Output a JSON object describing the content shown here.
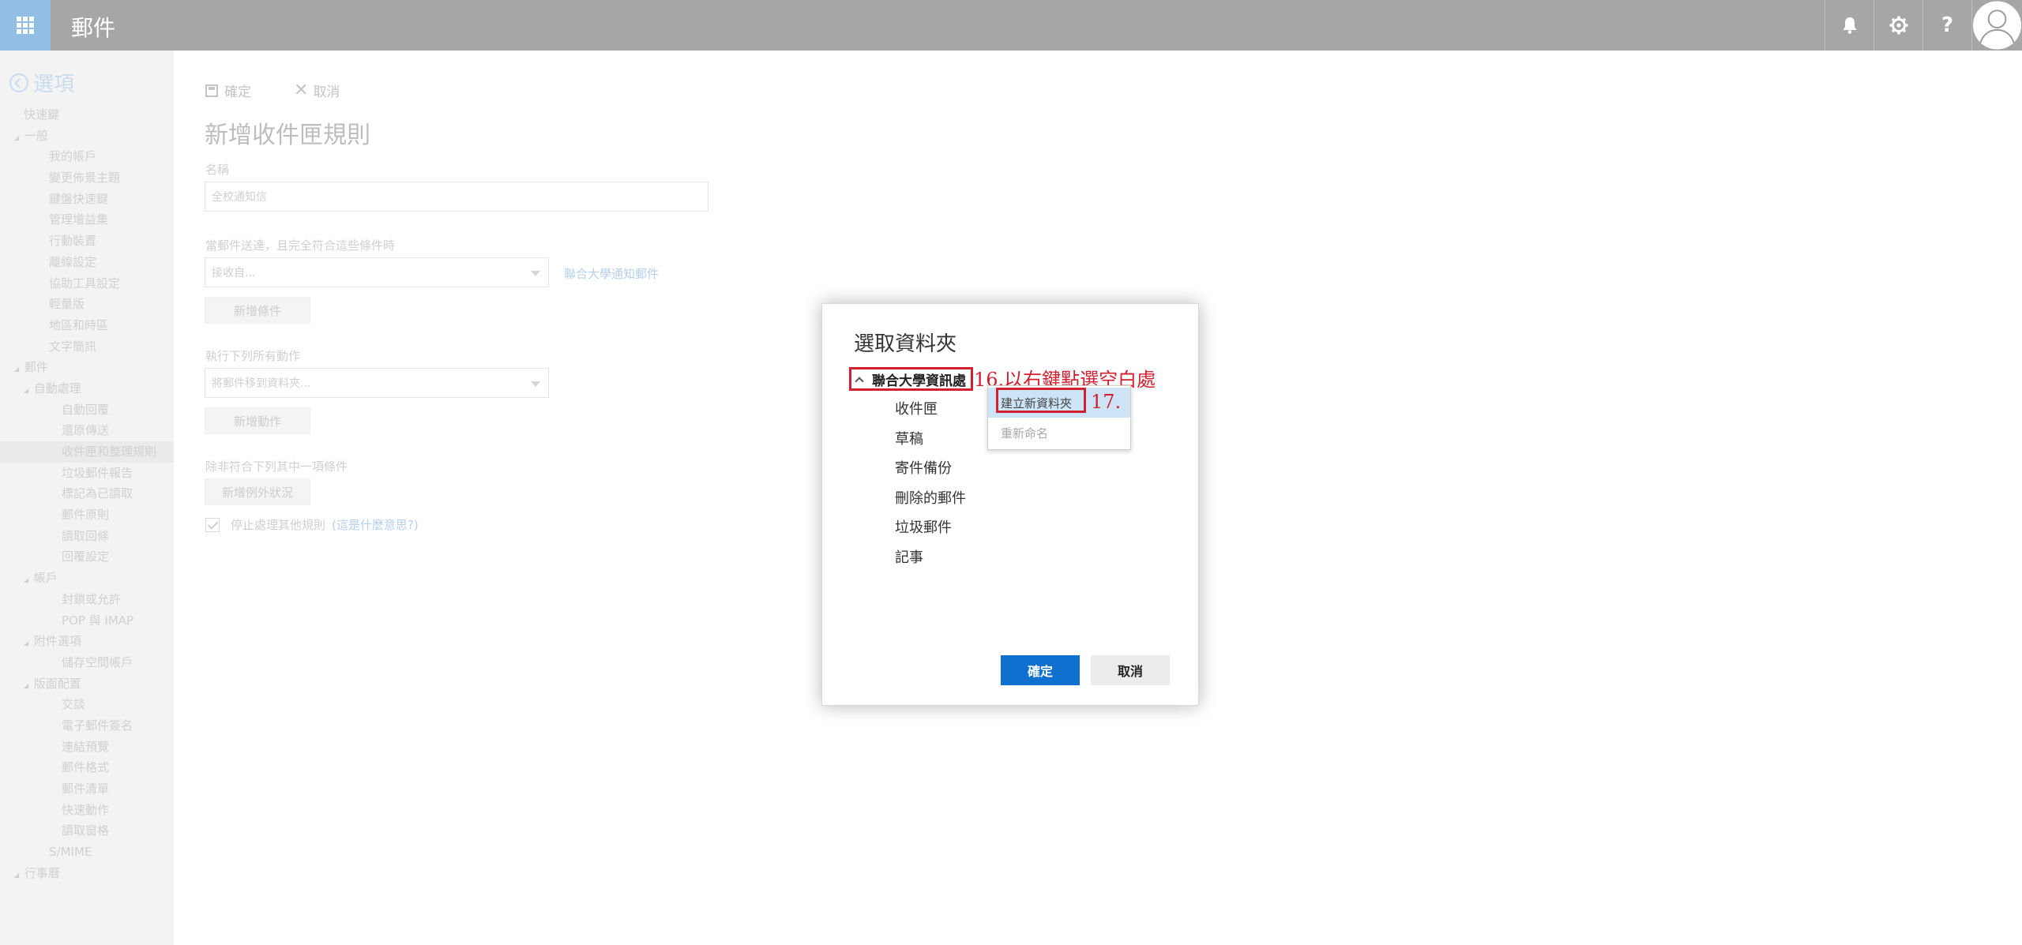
{
  "header": {
    "app_title": "郵件",
    "launcher_icon": "app-launcher-icon",
    "icons": [
      "bell-icon",
      "gear-icon",
      "help-icon",
      "avatar-icon"
    ],
    "help_label": "?"
  },
  "sidebar": {
    "title": "選項",
    "items": [
      {
        "label": "快速鍵",
        "indent": 30
      },
      {
        "label": "一般",
        "indent": 30,
        "caret": true
      },
      {
        "label": "我的帳戶",
        "indent": 62
      },
      {
        "label": "變更佈景主題",
        "indent": 62
      },
      {
        "label": "鍵盤快速鍵",
        "indent": 62
      },
      {
        "label": "管理增益集",
        "indent": 62
      },
      {
        "label": "行動裝置",
        "indent": 62
      },
      {
        "label": "離線設定",
        "indent": 62
      },
      {
        "label": "協助工具設定",
        "indent": 62
      },
      {
        "label": "輕量版",
        "indent": 62
      },
      {
        "label": "地區和時區",
        "indent": 62
      },
      {
        "label": "文字簡訊",
        "indent": 62
      },
      {
        "label": "郵件",
        "indent": 30,
        "caret": true
      },
      {
        "label": "自動處理",
        "indent": 42,
        "caret": true
      },
      {
        "label": "自動回覆",
        "indent": 78
      },
      {
        "label": "還原傳送",
        "indent": 78
      },
      {
        "label": "收件匣和整理規則",
        "indent": 78,
        "selected": true
      },
      {
        "label": "垃圾郵件報告",
        "indent": 78
      },
      {
        "label": "標記為已讀取",
        "indent": 78
      },
      {
        "label": "郵件原則",
        "indent": 78
      },
      {
        "label": "讀取回條",
        "indent": 78
      },
      {
        "label": "回覆設定",
        "indent": 78
      },
      {
        "label": "帳戶",
        "indent": 42,
        "caret": true
      },
      {
        "label": "封鎖或允許",
        "indent": 78
      },
      {
        "label": "POP 與 IMAP",
        "indent": 78
      },
      {
        "label": "附件選項",
        "indent": 42,
        "caret": true
      },
      {
        "label": "儲存空間帳戶",
        "indent": 78
      },
      {
        "label": "版面配置",
        "indent": 42,
        "caret": true
      },
      {
        "label": "交談",
        "indent": 78
      },
      {
        "label": "電子郵件簽名",
        "indent": 78
      },
      {
        "label": "連結預覽",
        "indent": 78
      },
      {
        "label": "郵件格式",
        "indent": 78
      },
      {
        "label": "郵件清單",
        "indent": 78
      },
      {
        "label": "快速動作",
        "indent": 78
      },
      {
        "label": "讀取窗格",
        "indent": 78
      },
      {
        "label": "S/MIME",
        "indent": 62
      },
      {
        "label": "行事曆",
        "indent": 30,
        "caret": true
      }
    ]
  },
  "main": {
    "save_label": "確定",
    "cancel_label": "取消",
    "page_title": "新增收件匣規則",
    "name_label": "名稱",
    "name_value": "全校通知信",
    "condition_label": "當郵件送達，且完全符合這些條件時",
    "condition_value": "接收自...",
    "condition_link": "聯合大學通知郵件",
    "add_condition": "新增條件",
    "action_label": "執行下列所有動作",
    "action_value": "將郵件移到資料夾...",
    "add_action": "新增動作",
    "exception_label": "除非符合下列其中一項條件",
    "add_exception": "新增例外狀況",
    "stop_label": "停止處理其他規則",
    "stop_link": "(這是什麼意思?)"
  },
  "dialog": {
    "title": "選取資料夾",
    "root_folder": "聯合大學資訊處",
    "annotation_16": "16.以右鍵點選空白處",
    "annotation_17": "17.",
    "folders": [
      "收件匣",
      "草稿",
      "寄件備份",
      "刪除的郵件",
      "垃圾郵件",
      "記事"
    ],
    "context_menu": {
      "new_folder": "建立新資料夾",
      "rename": "重新命名"
    },
    "ok_label": "確定",
    "cancel_label": "取消"
  },
  "colors": {
    "topbar": "#a6a6a6",
    "launcher": "#92bde4",
    "primary_button": "#0f70d0",
    "annotation_red": "#d32030",
    "menu_highlight": "#cde4f7"
  }
}
